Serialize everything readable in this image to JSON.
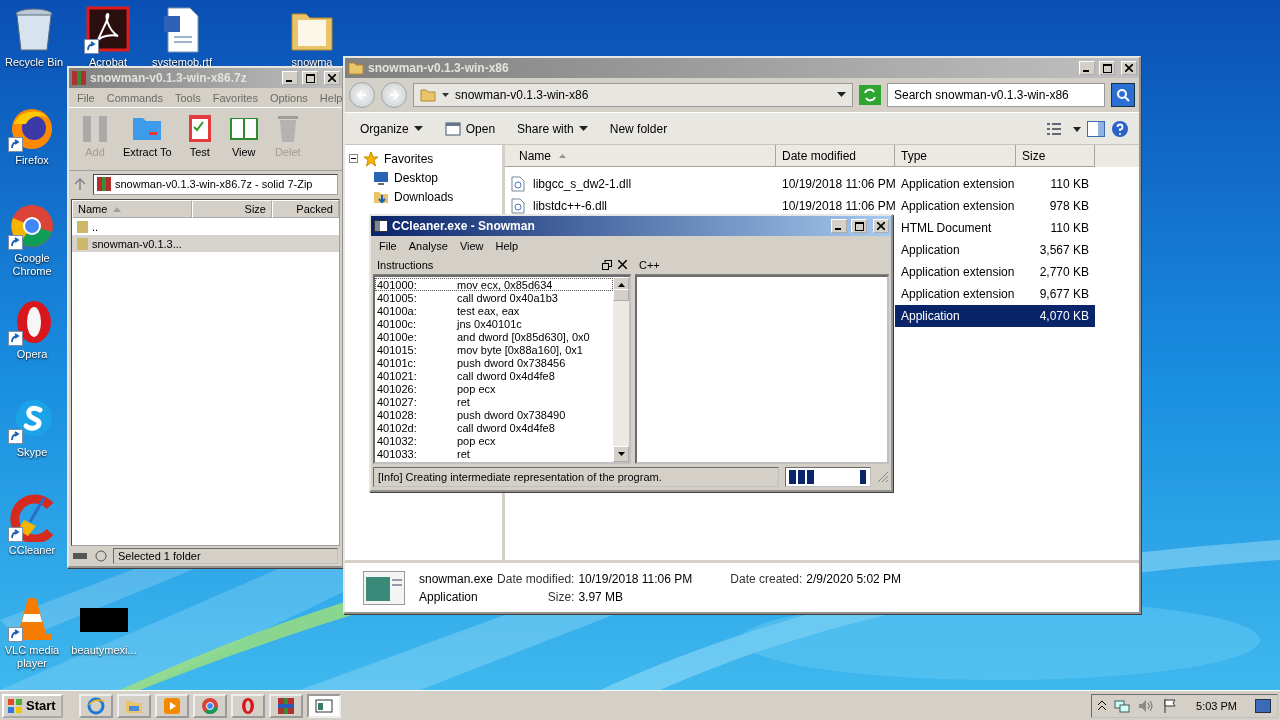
{
  "desktop_icons": [
    {
      "label": "Recycle Bin",
      "kind": "trash",
      "shortcut": false
    },
    {
      "label": "Acrobat",
      "kind": "acrobat",
      "shortcut": true
    },
    {
      "label": "systemob.rtf",
      "kind": "document",
      "shortcut": false
    },
    {
      "label": "snowma",
      "kind": "folder",
      "shortcut": false
    },
    {
      "label": "Firefox",
      "kind": "firefox",
      "shortcut": true
    },
    {
      "label": "Google Chrome",
      "kind": "chrome",
      "shortcut": true
    },
    {
      "label": "Opera",
      "kind": "opera",
      "shortcut": true
    },
    {
      "label": "Skype",
      "kind": "skype",
      "shortcut": true
    },
    {
      "label": "CCleaner",
      "kind": "ccleaner",
      "shortcut": true
    },
    {
      "label": "VLC media player",
      "kind": "vlc",
      "shortcut": true
    },
    {
      "label": "beautymexi...",
      "kind": "thumbnail",
      "shortcut": false
    }
  ],
  "archive_window": {
    "title": "snowman-v0.1.3-win-x86.7z",
    "active": false,
    "menu": [
      "File",
      "Commands",
      "Tools",
      "Favorites",
      "Options",
      "Help"
    ],
    "toolbar": [
      {
        "label": "Add",
        "kind": "add",
        "disabled": true
      },
      {
        "label": "Extract To",
        "kind": "extract",
        "disabled": false
      },
      {
        "label": "Test",
        "kind": "test",
        "disabled": false
      },
      {
        "label": "View",
        "kind": "view",
        "disabled": false
      },
      {
        "label": "Delet",
        "kind": "delete",
        "disabled": true
      }
    ],
    "path": "snowman-v0.1.3-win-x86.7z - solid 7-Zip",
    "columns": [
      "Name",
      "Size",
      "Packed"
    ],
    "rows": [
      {
        "name": "..",
        "selected": false
      },
      {
        "name": "snowman-v0.1.3...",
        "selected": true
      }
    ],
    "status": "Selected 1 folder"
  },
  "explorer_window": {
    "title": "snowman-v0.1.3-win-x86",
    "active": false,
    "address": "snowman-v0.1.3-win-x86",
    "search": {
      "placeholder": "Search snowman-v0.1.3-win-x86"
    },
    "commands": [
      {
        "label": "Organize",
        "kind": "menu"
      },
      {
        "label": "Open",
        "kind": "open"
      },
      {
        "label": "Share with",
        "kind": "menu"
      },
      {
        "label": "New folder",
        "kind": "plain"
      }
    ],
    "navigation": [
      {
        "label": "Favorites",
        "kind": "star",
        "expanded": true,
        "children": [
          {
            "label": "Desktop",
            "kind": "desktop"
          },
          {
            "label": "Downloads",
            "kind": "downloads"
          }
        ]
      }
    ],
    "columns": [
      "Name",
      "Date modified",
      "Type",
      "Size"
    ],
    "files": [
      {
        "name": "libgcc_s_dw2-1.dll",
        "date": "10/19/2018 11:06 PM",
        "type": "Application extension",
        "size": "110 KB",
        "selected": false
      },
      {
        "name": "libstdc++-6.dll",
        "date": "10/19/2018 11:06 PM",
        "type": "Application extension",
        "size": "978 KB",
        "selected": false
      },
      {
        "type": "HTML Document",
        "size": "110 KB",
        "selected": false
      },
      {
        "type": "Application",
        "size": "3,567 KB",
        "selected": false
      },
      {
        "type": "Application extension",
        "size": "2,770 KB",
        "selected": false
      },
      {
        "type": "Application extension",
        "size": "9,677 KB",
        "selected": false
      },
      {
        "type": "Application",
        "size": "4,070 KB",
        "selected": true
      }
    ],
    "details": {
      "name": "snowman.exe",
      "type": "Application",
      "fields": [
        {
          "label": "Date modified:",
          "value": "10/19/2018 11:06 PM"
        },
        {
          "label": "Date created:",
          "value": "2/9/2020 5:02 PM"
        },
        {
          "label": "Size:",
          "value": "3.97 MB"
        }
      ]
    }
  },
  "snowman_window": {
    "title": "CCleaner.exe - Snowman",
    "active": true,
    "menu": [
      "File",
      "Analyse",
      "View",
      "Help"
    ],
    "instructions_panel": {
      "title": "Instructions",
      "lines": [
        {
          "address": "401000:",
          "code": "mov ecx, 0x85d634",
          "focused": true
        },
        {
          "address": "401005:",
          "code": "call dword 0x40a1b3",
          "focused": false
        },
        {
          "address": "40100a:",
          "code": "test eax, eax",
          "focused": false
        },
        {
          "address": "40100c:",
          "code": "jns 0x40101c",
          "focused": false
        },
        {
          "address": "40100e:",
          "code": "and dword [0x85d630], 0x0",
          "focused": false
        },
        {
          "address": "401015:",
          "code": "mov byte [0x88a160], 0x1",
          "focused": false
        },
        {
          "address": "40101c:",
          "code": "push dword 0x738456",
          "focused": false
        },
        {
          "address": "401021:",
          "code": "call dword 0x4d4fe8",
          "focused": false
        },
        {
          "address": "401026:",
          "code": "pop ecx",
          "focused": false
        },
        {
          "address": "401027:",
          "code": "ret",
          "focused": false
        },
        {
          "address": "401028:",
          "code": "push dword 0x738490",
          "focused": false
        },
        {
          "address": "40102d:",
          "code": "call dword 0x4d4fe8",
          "focused": false
        },
        {
          "address": "401032:",
          "code": "pop ecx",
          "focused": false
        },
        {
          "address": "401033:",
          "code": "ret",
          "focused": false
        }
      ]
    },
    "code_panel": {
      "title": "C++"
    },
    "status": "[Info] Creating intermediate representation of the program."
  },
  "taskbar": {
    "start": "Start",
    "items": [
      {
        "kind": "ie",
        "active": false
      },
      {
        "kind": "explorer",
        "active": false
      },
      {
        "kind": "media",
        "active": false
      },
      {
        "kind": "chrome",
        "active": false
      },
      {
        "kind": "opera",
        "active": false
      },
      {
        "kind": "archiver",
        "active": false
      },
      {
        "kind": "snowman",
        "active": true
      }
    ],
    "clock": "5:03 PM"
  }
}
